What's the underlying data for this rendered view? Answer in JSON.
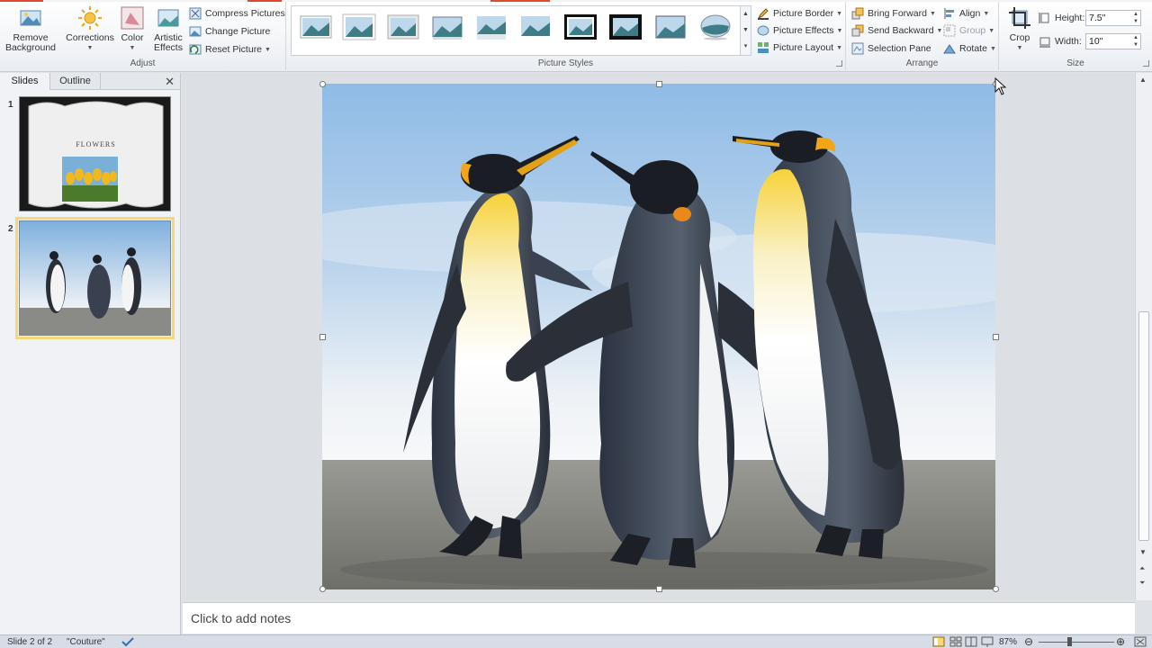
{
  "ribbon": {
    "groups": {
      "adjust": {
        "label": "Adjust",
        "remove_background": "Remove Background",
        "corrections": "Corrections",
        "color": "Color",
        "artistic_effects": "Artistic Effects",
        "compress_pictures": "Compress Pictures",
        "change_picture": "Change Picture",
        "reset_picture": "Reset Picture"
      },
      "picture_styles": {
        "label": "Picture Styles",
        "picture_border": "Picture Border",
        "picture_effects": "Picture Effects",
        "picture_layout": "Picture Layout"
      },
      "arrange": {
        "label": "Arrange",
        "bring_forward": "Bring Forward",
        "send_backward": "Send Backward",
        "selection_pane": "Selection Pane",
        "align": "Align",
        "group": "Group",
        "rotate": "Rotate"
      },
      "size": {
        "label": "Size",
        "crop": "Crop",
        "height_label": "Height:",
        "height_value": "7.5\"",
        "width_label": "Width:",
        "width_value": "10\""
      }
    }
  },
  "left_pane": {
    "tabs": [
      "Slides",
      "Outline"
    ],
    "slides": [
      {
        "number": "1",
        "title": "FLOWERS"
      },
      {
        "number": "2",
        "title": ""
      }
    ]
  },
  "notes": {
    "placeholder": "Click to add notes"
  },
  "status_bar": {
    "slide_info": "Slide 2 of 2",
    "theme": "\"Couture\"",
    "zoom": "87%"
  },
  "colors": {
    "accent_selection": "#f7d876",
    "ribbon_accent": "#e0482f"
  }
}
